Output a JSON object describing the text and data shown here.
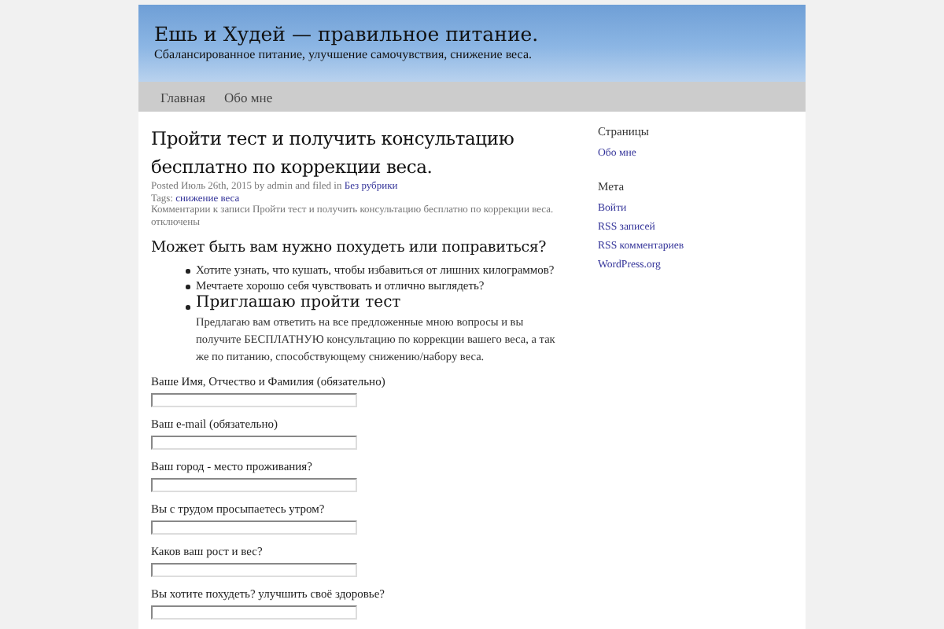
{
  "header": {
    "title": "Ешь и Худей — правильное питание.",
    "tagline": "Сбалансированное питание, улучшение самочувствия, снижение веса."
  },
  "nav": [
    {
      "label": "Главная",
      "selected": false
    },
    {
      "label": "Обо мне",
      "selected": false
    }
  ],
  "post": {
    "title": "Пройти тест и получить консультацию бесплатно по коррекции веса.",
    "meta": {
      "posted": "Posted Июль 26th, 2015 by admin and filed in",
      "category": "Без рубрики",
      "tags_label": "Tags:",
      "tag": "снижение веса",
      "comments": "Комментарии к записи Пройти тест и получить консультацию бесплатно по коррекции веса. отключены"
    },
    "heading": "Может быть вам нужно похудеть или поправиться?",
    "bullets": [
      "Хотите узнать, что кушать, чтобы избавиться от лишних килограммов?",
      "Мечтаете хорошо себя чувствовать и отлично выглядеть?"
    ],
    "invite": {
      "title": "Приглашаю пройти тест",
      "text": "Предлагаю вам ответить на все предложенные мною вопросы и вы получите БЕСПЛАТНУЮ консультацию по коррекции вашего веса, а так же по питанию, способствующему снижению/набору веса."
    },
    "form": [
      "Ваше Имя, Отчество и Фамилия (обязательно)",
      "Ваш e-mail (обязательно)",
      "Ваш город - место проживания?",
      "Вы с трудом просыпаетесь утром?",
      "Каков ваш рост и вес?",
      "Вы хотите похудеть? улучшить своё здоровье?"
    ]
  },
  "sidebar": [
    {
      "title": "Страницы",
      "links": [
        "Обо мне"
      ]
    },
    {
      "title": "Мета",
      "links": [
        "Войти",
        "RSS записей",
        "RSS комментариев",
        "WordPress.org"
      ]
    }
  ]
}
